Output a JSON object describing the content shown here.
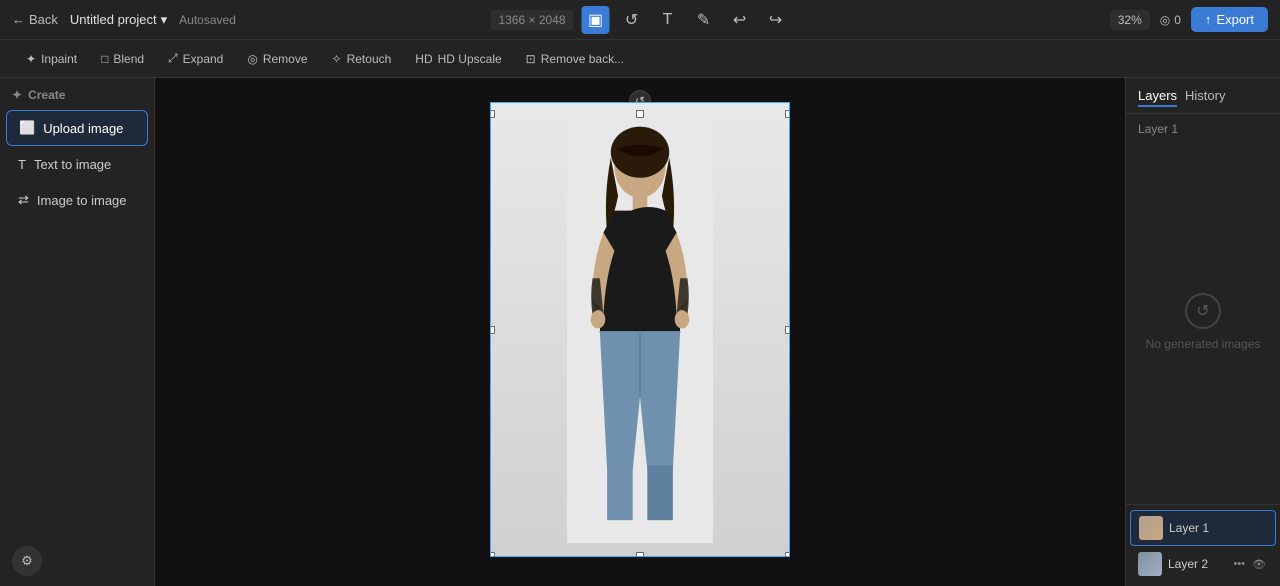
{
  "topbar": {
    "back_label": "Back",
    "project_name": "Untitled project",
    "autosaved": "Autosaved",
    "canvas_size": "1366 × 2048",
    "zoom": "32%",
    "credits": "0",
    "export_label": "Export"
  },
  "toolbar": {
    "inpaint_label": "Inpaint",
    "blend_label": "Blend",
    "expand_label": "Expand",
    "remove_label": "Remove",
    "retouch_label": "Retouch",
    "upscale_label": "HD Upscale",
    "remove_background_label": "Remove back..."
  },
  "sidebar": {
    "create_label": "Create",
    "upload_image_label": "Upload image",
    "text_to_image_label": "Text to image",
    "image_to_image_label": "Image to image"
  },
  "right_panel": {
    "layers_tab": "Layers",
    "history_tab": "History",
    "no_images_text": "No generated images",
    "layer1_name": "Layer 1",
    "layer2_name": "Layer 2",
    "top_layer_name": "Layer 1"
  }
}
